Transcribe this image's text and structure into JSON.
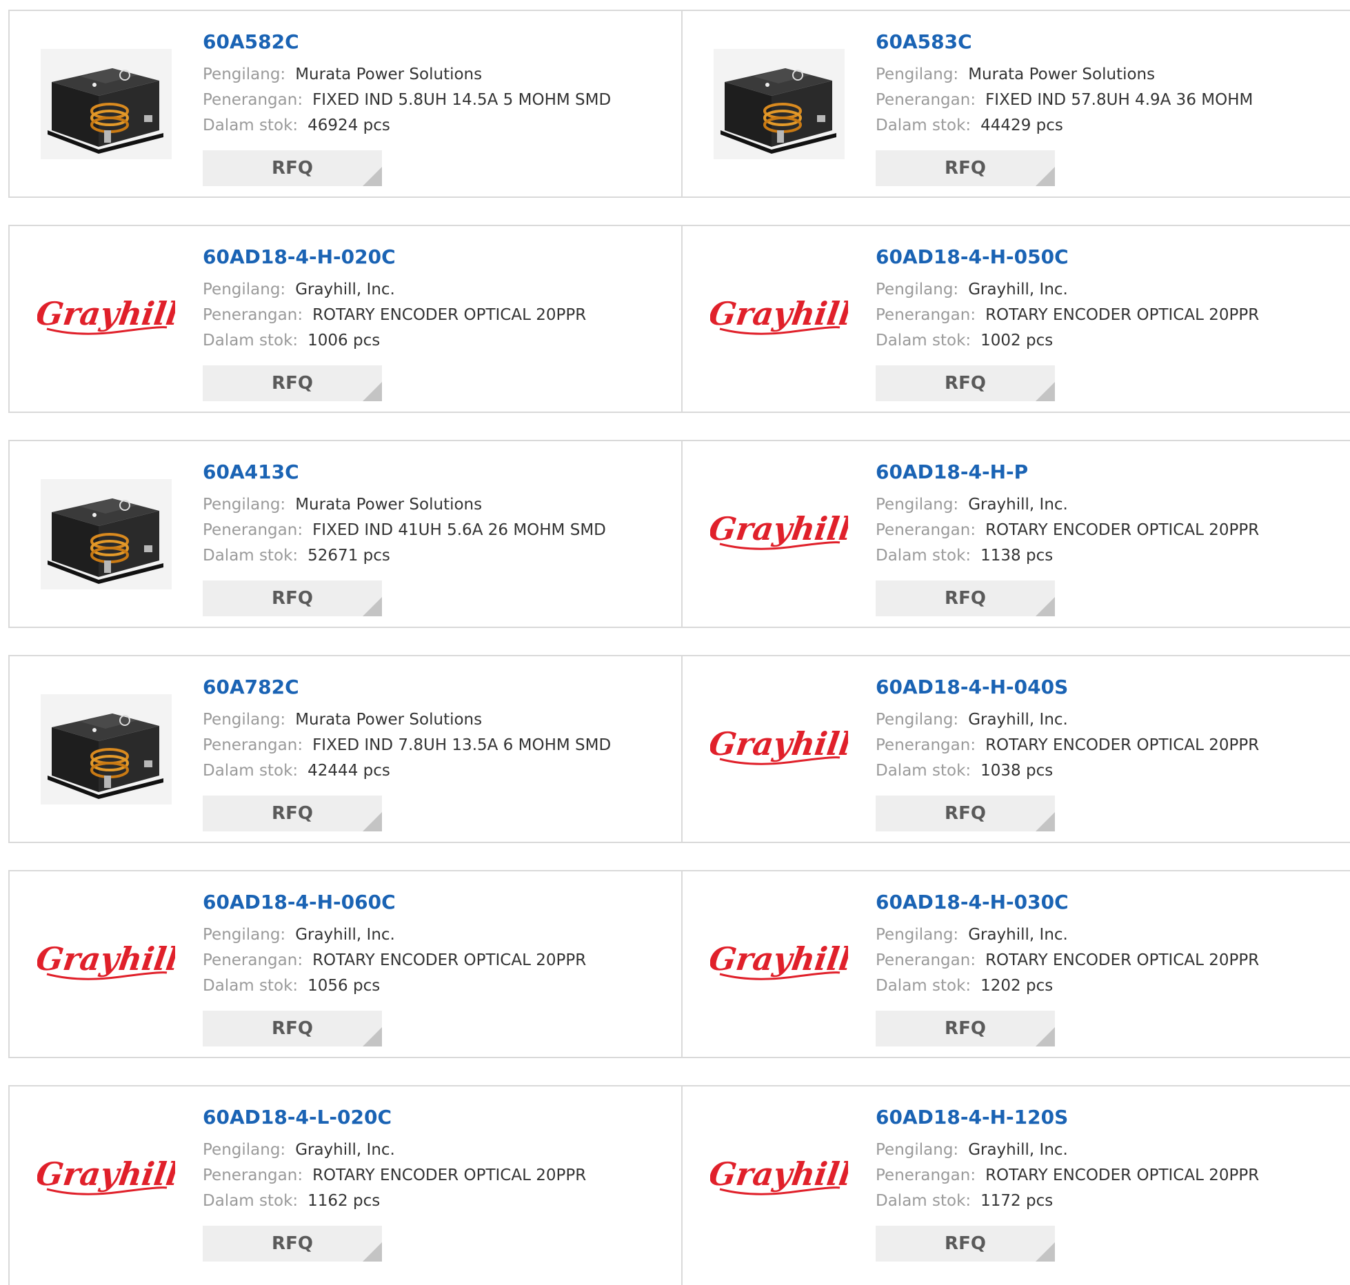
{
  "labels": {
    "manufacturer": "Pengilang:",
    "description": "Penerangan:",
    "stock": "Dalam stok:",
    "rfq": "RFQ"
  },
  "brand_logo_text": "Grayhill",
  "colors": {
    "part_link": "#1a63b4",
    "label": "#9a9a9a",
    "value": "#333333",
    "rfq_bg": "#eeeeee",
    "border": "#d9d9d9",
    "grayhill_red": "#e0202a"
  },
  "products": [
    {
      "part": "60A582C",
      "manufacturer": "Murata Power Solutions",
      "description": "FIXED IND 5.8UH 14.5A 5 MOHM SMD",
      "stock": "46924 pcs",
      "image": "inductor-photo"
    },
    {
      "part": "60A583C",
      "manufacturer": "Murata Power Solutions",
      "description": "FIXED IND 57.8UH 4.9A 36 MOHM",
      "stock": "44429 pcs",
      "image": "inductor-photo"
    },
    {
      "part": "60AD18-4-H-020C",
      "manufacturer": "Grayhill, Inc.",
      "description": "ROTARY ENCODER OPTICAL 20PPR",
      "stock": "1006 pcs",
      "image": "grayhill-logo"
    },
    {
      "part": "60AD18-4-H-050C",
      "manufacturer": "Grayhill, Inc.",
      "description": "ROTARY ENCODER OPTICAL 20PPR",
      "stock": "1002 pcs",
      "image": "grayhill-logo"
    },
    {
      "part": "60A413C",
      "manufacturer": "Murata Power Solutions",
      "description": "FIXED IND 41UH 5.6A 26 MOHM SMD",
      "stock": "52671 pcs",
      "image": "inductor-photo"
    },
    {
      "part": "60AD18-4-H-P",
      "manufacturer": "Grayhill, Inc.",
      "description": "ROTARY ENCODER OPTICAL 20PPR",
      "stock": "1138 pcs",
      "image": "grayhill-logo"
    },
    {
      "part": "60A782C",
      "manufacturer": "Murata Power Solutions",
      "description": "FIXED IND 7.8UH 13.5A 6 MOHM SMD",
      "stock": "42444 pcs",
      "image": "inductor-photo"
    },
    {
      "part": "60AD18-4-H-040S",
      "manufacturer": "Grayhill, Inc.",
      "description": "ROTARY ENCODER OPTICAL 20PPR",
      "stock": "1038 pcs",
      "image": "grayhill-logo"
    },
    {
      "part": "60AD18-4-H-060C",
      "manufacturer": "Grayhill, Inc.",
      "description": "ROTARY ENCODER OPTICAL 20PPR",
      "stock": "1056 pcs",
      "image": "grayhill-logo"
    },
    {
      "part": "60AD18-4-H-030C",
      "manufacturer": "Grayhill, Inc.",
      "description": "ROTARY ENCODER OPTICAL 20PPR",
      "stock": "1202 pcs",
      "image": "grayhill-logo"
    },
    {
      "part": "60AD18-4-L-020C",
      "manufacturer": "Grayhill, Inc.",
      "description": "ROTARY ENCODER OPTICAL 20PPR",
      "stock": "1162 pcs",
      "image": "grayhill-logo"
    },
    {
      "part": "60AD18-4-H-120S",
      "manufacturer": "Grayhill, Inc.",
      "description": "ROTARY ENCODER OPTICAL 20PPR",
      "stock": "1172 pcs",
      "image": "grayhill-logo"
    }
  ]
}
